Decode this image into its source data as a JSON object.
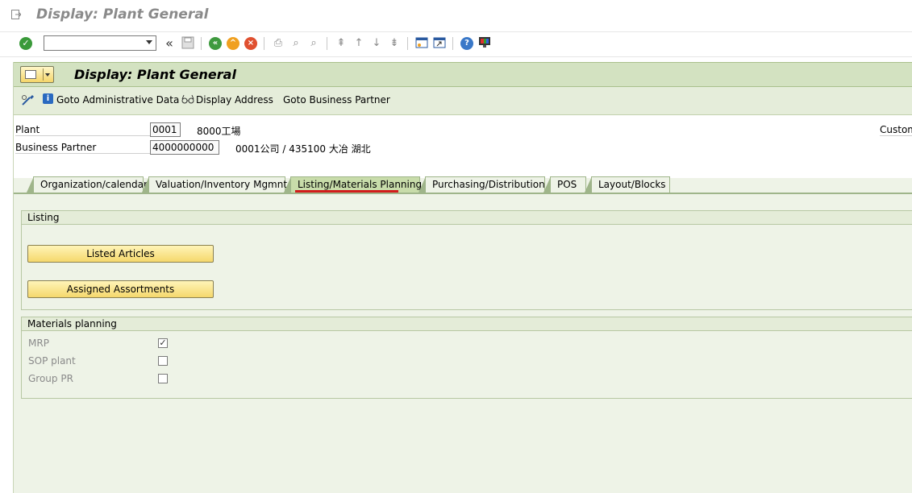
{
  "window": {
    "title": "Display: Plant General"
  },
  "toolbar": {
    "command_placeholder": "",
    "icons": [
      "enter-icon",
      "command-dropdown-icon",
      "collapse-icon",
      "save-icon",
      "back-icon",
      "exit-icon",
      "cancel-icon",
      "print-icon",
      "find-icon",
      "find-next-icon",
      "first-page-icon",
      "previous-page-icon",
      "next-page-icon",
      "last-page-icon",
      "new-session-icon",
      "shortcut-icon",
      "help-icon",
      "layout-icon"
    ],
    "collapse_glyph": "«"
  },
  "app": {
    "title": "Display: Plant General",
    "actions": {
      "goto_admin": "Goto Administrative Data",
      "display_address": "Display Address",
      "goto_bp": "Goto Business Partner"
    }
  },
  "header": {
    "plant_label": "Plant",
    "plant_value": "0001",
    "plant_desc": "8000工場",
    "bp_label": "Business Partner",
    "bp_value": "4000000000",
    "bp_desc": "0001公司 / 435100 大冶 湖北",
    "custom_label": "Custom"
  },
  "tabs": [
    {
      "label": "Organization/calendar",
      "active": false
    },
    {
      "label": "Valuation/Inventory Mgmnt",
      "active": false
    },
    {
      "label": "Listing/Materials Planning",
      "active": true
    },
    {
      "label": "Purchasing/Distribution",
      "active": false
    },
    {
      "label": "POS",
      "active": false
    },
    {
      "label": "Layout/Blocks",
      "active": false
    }
  ],
  "listing": {
    "title": "Listing",
    "listed_articles": "Listed Articles",
    "assigned_assortments": "Assigned Assortments"
  },
  "materials_planning": {
    "title": "Materials planning",
    "items": [
      {
        "label": "MRP",
        "checked": true
      },
      {
        "label": "SOP plant",
        "checked": false
      },
      {
        "label": "Group PR",
        "checked": false
      }
    ]
  },
  "colors": {
    "accent": "#d3e2c1",
    "button": "#f5d86c",
    "active_tab_underline": "#d21b1b"
  }
}
